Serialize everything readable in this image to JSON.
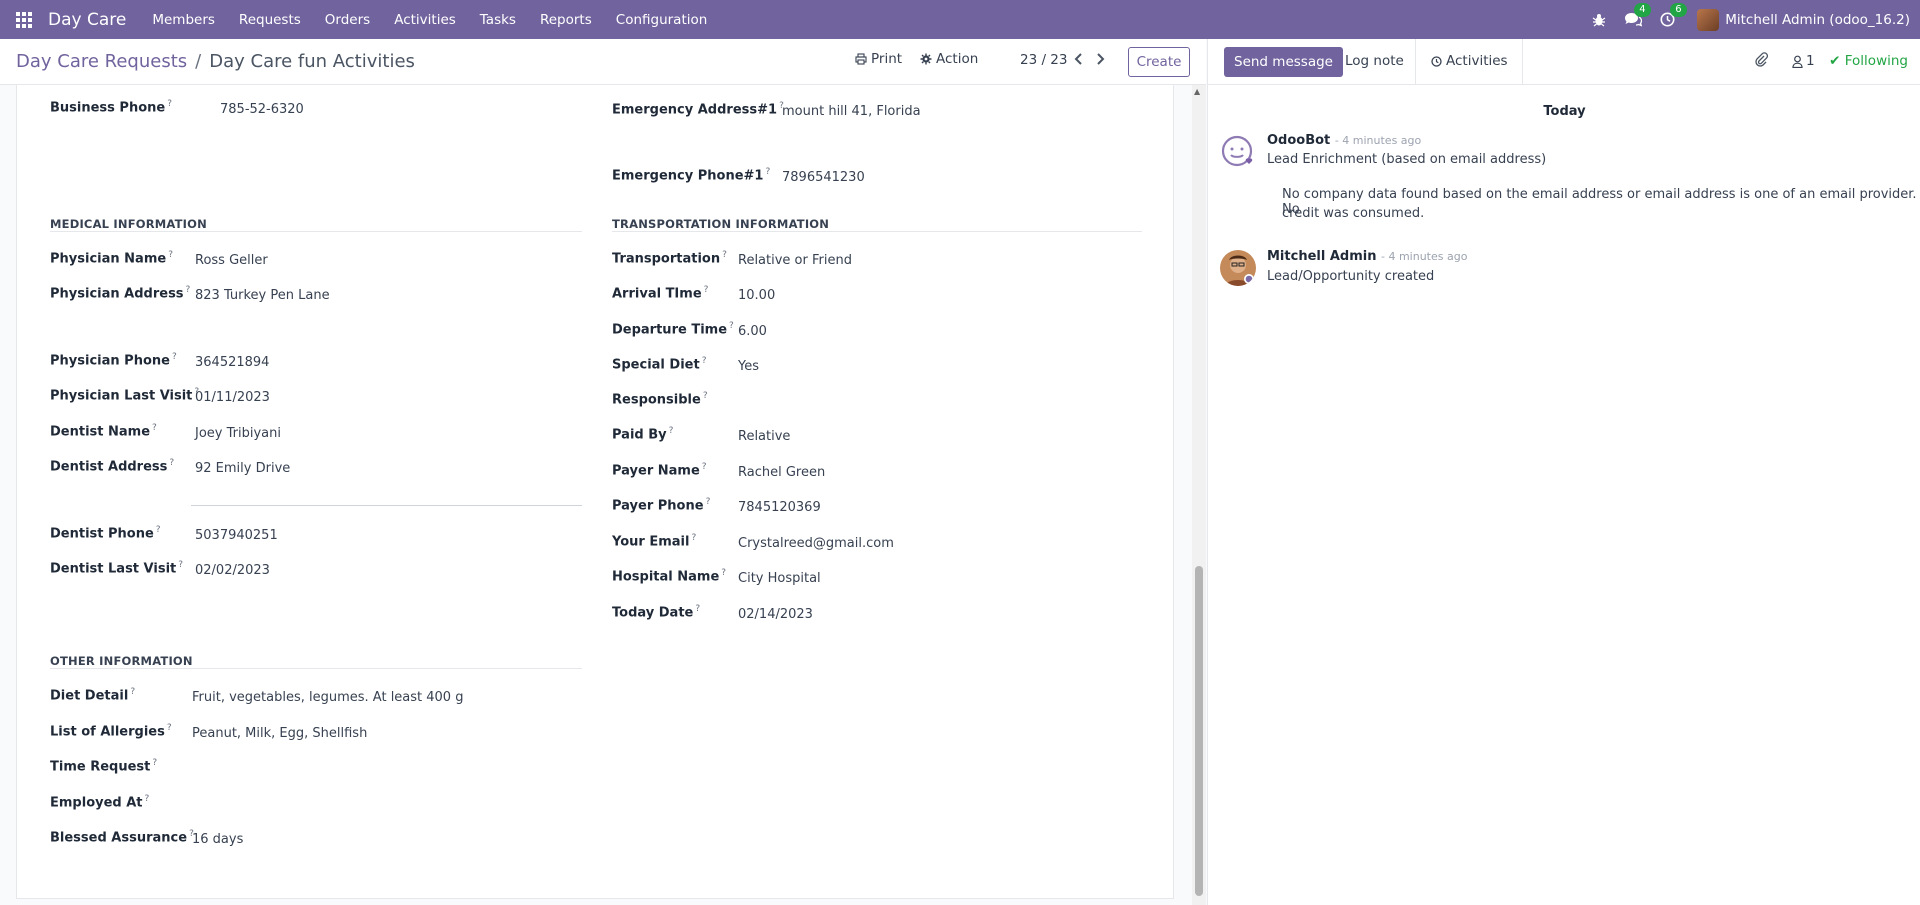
{
  "navbar": {
    "brand": "Day Care",
    "menu": [
      "Members",
      "Requests",
      "Orders",
      "Activities",
      "Tasks",
      "Reports",
      "Configuration"
    ],
    "messages_count": "4",
    "activities_count": "6",
    "user": "Mitchell Admin (odoo_16.2)",
    "accent": "#71639e"
  },
  "control": {
    "breadcrumb_parent": "Day Care Requests",
    "breadcrumb_sep": "/",
    "breadcrumb_current": "Day Care fun Activities",
    "print": "Print",
    "action": "Action",
    "pager": "23 / 23",
    "create": "Create"
  },
  "chatter": {
    "send_message": "Send message",
    "log_note": "Log note",
    "activities": "Activities",
    "followers": "1",
    "following": "Following",
    "today": "Today",
    "messages": [
      {
        "author": "OdooBot",
        "time": "- 4 minutes ago",
        "title": "Lead Enrichment (based on email address)",
        "body_line1": "No company data found based on the email address or email address is one of an email provider. No",
        "body_line2": "credit was consumed."
      },
      {
        "author": "Mitchell Admin",
        "time": "- 4 minutes ago",
        "title": "Lead/Opportunity created"
      }
    ]
  },
  "form": {
    "top_left": [
      {
        "label": "Business Phone",
        "value": "785-52-6320"
      }
    ],
    "top_right": [
      {
        "label": "Emergency Address#1",
        "value": "mount hill 41, Florida"
      },
      {
        "label": "Emergency Phone#1",
        "value": "7896541230"
      }
    ],
    "medical": {
      "title": "MEDICAL INFORMATION",
      "fields": [
        {
          "label": "Physician Name",
          "value": "Ross Geller"
        },
        {
          "label": "Physician Address",
          "value": "823 Turkey Pen Lane"
        },
        {
          "label": "Physician Phone",
          "value": "364521894"
        },
        {
          "label": "Physician Last Visit",
          "value": "01/11/2023"
        },
        {
          "label": "Dentist Name",
          "value": "Joey Tribiyani"
        },
        {
          "label": "Dentist Address",
          "value": "92 Emily Drive"
        },
        {
          "label": "Dentist Phone",
          "value": "5037940251"
        },
        {
          "label": "Dentist Last Visit",
          "value": "02/02/2023"
        }
      ]
    },
    "transport": {
      "title": "TRANSPORTATION INFORMATION",
      "fields": [
        {
          "label": "Transportation",
          "value": "Relative or Friend"
        },
        {
          "label": "Arrival TIme",
          "value": "10.00"
        },
        {
          "label": "Departure Time",
          "value": "6.00"
        },
        {
          "label": "Special Diet",
          "value": "Yes"
        },
        {
          "label": "Responsible",
          "value": ""
        },
        {
          "label": "Paid By",
          "value": "Relative"
        },
        {
          "label": "Payer Name",
          "value": "Rachel Green"
        },
        {
          "label": "Payer Phone",
          "value": "7845120369"
        },
        {
          "label": "Your Email",
          "value": "Crystalreed@gmail.com"
        },
        {
          "label": "Hospital Name",
          "value": "City Hospital"
        },
        {
          "label": "Today Date",
          "value": "02/14/2023"
        }
      ]
    },
    "other": {
      "title": "OTHER INFORMATION",
      "fields": [
        {
          "label": "Diet Detail",
          "value": "Fruit, vegetables, legumes. At least 400 g"
        },
        {
          "label": "List of Allergies",
          "value": "Peanut, Milk, Egg, Shellfish"
        },
        {
          "label": "Time Request",
          "value": ""
        },
        {
          "label": "Employed At",
          "value": ""
        },
        {
          "label": "Blessed Assurance",
          "value": "16 days"
        }
      ]
    }
  }
}
